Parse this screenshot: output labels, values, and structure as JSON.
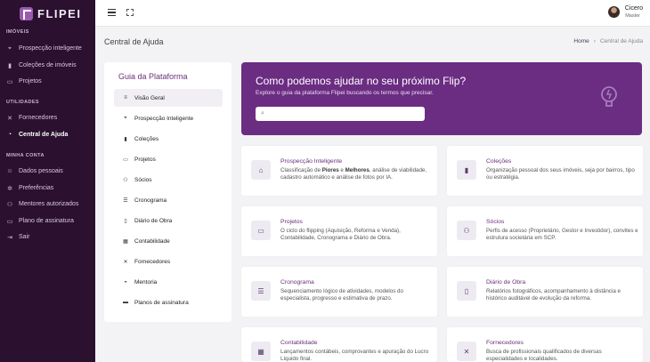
{
  "app": {
    "logo_text": "FLIPEI"
  },
  "sidebar": {
    "sections": [
      {
        "label": "IMÓVEIS"
      },
      {
        "label": "UTILIDADES"
      },
      {
        "label": "MINHA CONTA"
      }
    ],
    "items": [
      {
        "label": "Prospecção inteligente",
        "icon": "location-pin-icon"
      },
      {
        "label": "Coleções de imóveis",
        "icon": "bookmark-icon"
      },
      {
        "label": "Projetos",
        "icon": "folder-icon"
      },
      {
        "label": "Fornecedores",
        "icon": "tools-icon"
      },
      {
        "label": "Central de Ajuda",
        "icon": "help-circle-icon"
      },
      {
        "label": "Dados pessoais",
        "icon": "user-icon"
      },
      {
        "label": "Preferências",
        "icon": "gear-icon"
      },
      {
        "label": "Mentores autorizados",
        "icon": "users-icon"
      },
      {
        "label": "Plano de assinatura",
        "icon": "card-icon"
      },
      {
        "label": "Sair",
        "icon": "logout-icon"
      }
    ]
  },
  "topbar": {
    "user_name": "Cicero",
    "user_role": "Master"
  },
  "page": {
    "title": "Central de Ajuda",
    "breadcrumb": {
      "home": "Home",
      "separator": "›",
      "current": "Central de Ajuda"
    }
  },
  "guide": {
    "title": "Guia da Plataforma",
    "items": [
      {
        "label": "Visão Geral",
        "icon": "list-icon"
      },
      {
        "label": "Prospecção Inteligente",
        "icon": "location-pin-icon"
      },
      {
        "label": "Coleções",
        "icon": "bookmark-icon"
      },
      {
        "label": "Projetos",
        "icon": "folder-icon"
      },
      {
        "label": "Sócios",
        "icon": "users-icon"
      },
      {
        "label": "Cronograma",
        "icon": "timeline-icon"
      },
      {
        "label": "Diário de Obra",
        "icon": "book-icon"
      },
      {
        "label": "Contabilidade",
        "icon": "calculator-icon"
      },
      {
        "label": "Fornecedores",
        "icon": "tools-icon"
      },
      {
        "label": "Mentoria",
        "icon": "mentor-icon"
      },
      {
        "label": "Planos de assinatura",
        "icon": "card-icon"
      }
    ]
  },
  "hero": {
    "title": "Como podemos ajudar no seu próximo Flip?",
    "subtitle": "Explore o guia da plataforma Flipei buscando os termos que precisar.",
    "search_value": ""
  },
  "cards": [
    {
      "title": "Prospecção Inteligente",
      "desc_pre": "Classificação de ",
      "desc_b1": "Piores",
      "desc_mid": " e ",
      "desc_b2": "Melhores",
      "desc_post": ", análise de viabilidade, cadastro automático e análise de fotos por IA.",
      "icon": "home-icon"
    },
    {
      "title": "Coleções",
      "desc": "Organização pessoal dos seus imóveis, seja por bairros, tipo ou estratégia.",
      "icon": "bookmark-icon"
    },
    {
      "title": "Projetos",
      "desc": "O ciclo do flipping (Aquisição, Reforma e Venda), Contabilidade, Cronograma e Diário de Obra.",
      "icon": "folder-icon"
    },
    {
      "title": "Sócios",
      "desc": "Perfis de acesso (Proprietário, Gestor e Investidor), convites e estrutura societária em SCP.",
      "icon": "users-icon"
    },
    {
      "title": "Cronograma",
      "desc": "Sequenciamento lógico de atividades, modelos do especialista, progresso e estimativa de prazo.",
      "icon": "timeline-icon"
    },
    {
      "title": "Diário de Obra",
      "desc": "Relatórios fotográficos, acompanhamento à distância e histórico auditável de evolução da reforma.",
      "icon": "book-icon"
    },
    {
      "title": "Contabilidade",
      "desc": "Lançamentos contábeis, comprovantes e apuração do Lucro Líquido final.",
      "icon": "calculator-icon"
    },
    {
      "title": "Fornecedores",
      "desc": "Busca de profissionais qualificados de diversas especialidades e localidades.",
      "icon": "tools-icon"
    }
  ],
  "colors": {
    "sidebar": "#2b1030",
    "accent": "#6b2d82",
    "background": "#f3f3f6"
  }
}
